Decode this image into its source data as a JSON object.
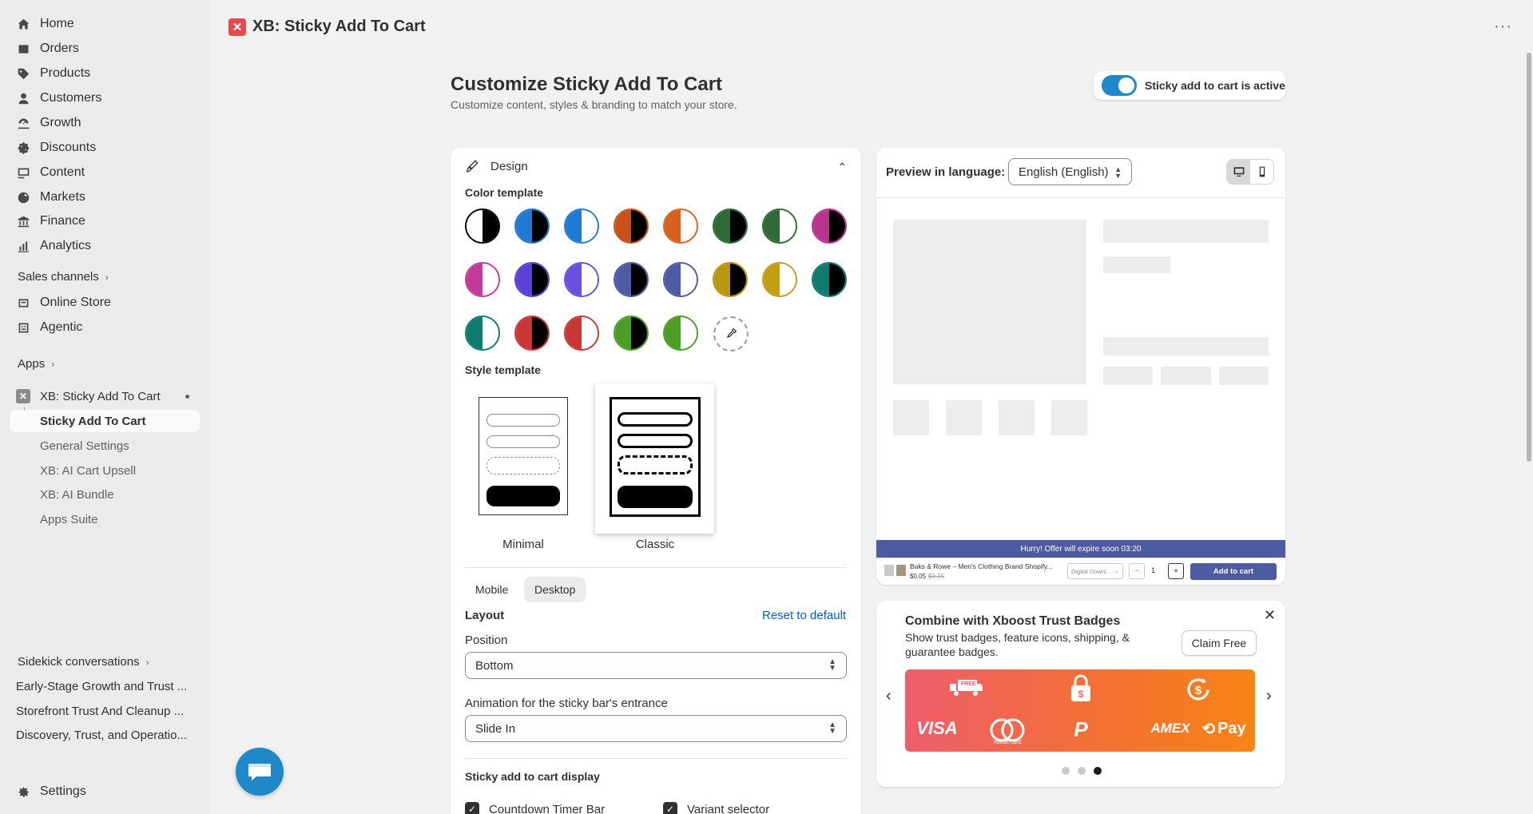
{
  "sidebar": {
    "nav": [
      {
        "label": "Home",
        "icon": "home-icon"
      },
      {
        "label": "Orders",
        "icon": "orders-icon"
      },
      {
        "label": "Products",
        "icon": "tag-icon"
      },
      {
        "label": "Customers",
        "icon": "person-icon"
      },
      {
        "label": "Growth",
        "icon": "growth-icon"
      },
      {
        "label": "Discounts",
        "icon": "discount-icon"
      },
      {
        "label": "Content",
        "icon": "content-icon"
      },
      {
        "label": "Markets",
        "icon": "globe-icon"
      },
      {
        "label": "Finance",
        "icon": "bank-icon"
      },
      {
        "label": "Analytics",
        "icon": "chart-icon"
      }
    ],
    "sales_channels_label": "Sales channels",
    "channels": [
      {
        "label": "Online Store",
        "icon": "store-icon"
      },
      {
        "label": "Agentic",
        "icon": "agentic-icon"
      }
    ],
    "apps_label": "Apps",
    "app_name": "XB: Sticky Add To Cart",
    "app_subitems": [
      "Sticky Add To Cart",
      "General Settings",
      "XB: AI Cart Upsell",
      "XB: AI Bundle",
      "Apps Suite"
    ],
    "sidekick_label": "Sidekick conversations",
    "conversations": [
      "Early-Stage Growth and Trust ...",
      "Storefront Trust And Cleanup ...",
      "Discovery, Trust, and Operatio..."
    ],
    "settings_label": "Settings"
  },
  "header": {
    "app_title": "XB: Sticky Add To Cart",
    "more": "···"
  },
  "page": {
    "title": "Customize Sticky Add To Cart",
    "subtitle": "Customize content, styles & branding to match your store.",
    "toggle_label": "Sticky add to cart is active",
    "toggle_on": true
  },
  "design": {
    "heading": "Design",
    "color_template_label": "Color template",
    "swatches": [
      {
        "left": "#ffffff",
        "right": "#000000",
        "selected": true
      },
      {
        "left": "#1f7ad3",
        "right": "#000000"
      },
      {
        "left": "#1f7ad3",
        "right": "#ffffff"
      },
      {
        "left": "#c8501a",
        "right": "#000000"
      },
      {
        "left": "#d9601c",
        "right": "#ffffff"
      },
      {
        "left": "#2e6b34",
        "right": "#000000"
      },
      {
        "left": "#2e6b34",
        "right": "#ffffff"
      },
      {
        "left": "#b8338e",
        "right": "#000000"
      },
      {
        "left": "#c2399a",
        "right": "#ffffff"
      },
      {
        "left": "#5b3fd6",
        "right": "#000000"
      },
      {
        "left": "#6a4ee0",
        "right": "#ffffff"
      },
      {
        "left": "#4d5ba3",
        "right": "#000000"
      },
      {
        "left": "#4d5ba3",
        "right": "#ffffff"
      },
      {
        "left": "#b8960f",
        "right": "#000000"
      },
      {
        "left": "#c29e12",
        "right": "#ffffff"
      },
      {
        "left": "#0d7c6e",
        "right": "#000000"
      },
      {
        "left": "#0d7c6e",
        "right": "#ffffff"
      },
      {
        "left": "#c93636",
        "right": "#000000"
      },
      {
        "left": "#c93636",
        "right": "#ffffff"
      },
      {
        "left": "#4a9e25",
        "right": "#000000"
      },
      {
        "left": "#4a9e25",
        "right": "#ffffff"
      }
    ],
    "style_template_label": "Style template",
    "styles": [
      "Minimal",
      "Classic"
    ],
    "selected_style": "Classic",
    "tabs": [
      "Mobile",
      "Desktop"
    ],
    "selected_tab": "Desktop",
    "layout_label": "Layout",
    "reset_label": "Reset to default",
    "position_label": "Position",
    "position_value": "Bottom",
    "animation_label": "Animation for the sticky bar's entrance",
    "animation_value": "Slide In",
    "display_label": "Sticky add to cart display",
    "checks": [
      {
        "label": "Countdown Timer Bar",
        "checked": true
      },
      {
        "label": "Variant selector",
        "checked": true
      }
    ]
  },
  "preview": {
    "language_label": "Preview in language:",
    "language_value": "English (English)",
    "timer_text": "Hurry! Offer will expire soon 03:20",
    "product_name": "Baks & Rowe – Men's Clothing Brand Shopify...",
    "price": "$0.05",
    "compare_price": "$0.15",
    "variant_placeholder": "Digital Downl...",
    "quantity": "1",
    "add_to_cart": "Add to cart",
    "accent_color": "#4d5ba3"
  },
  "promo": {
    "title": "Combine with Xboost Trust Badges",
    "description": "Show trust badges, feature icons, shipping, & guarantee badges.",
    "button": "Claim Free",
    "badges": {
      "free": "FREE",
      "visa": "VISA",
      "mastercard": "mastercard",
      "paypal": "P",
      "amex": "AMEX",
      "pay": "Pay"
    },
    "dots": 3,
    "active_dot": 3
  }
}
